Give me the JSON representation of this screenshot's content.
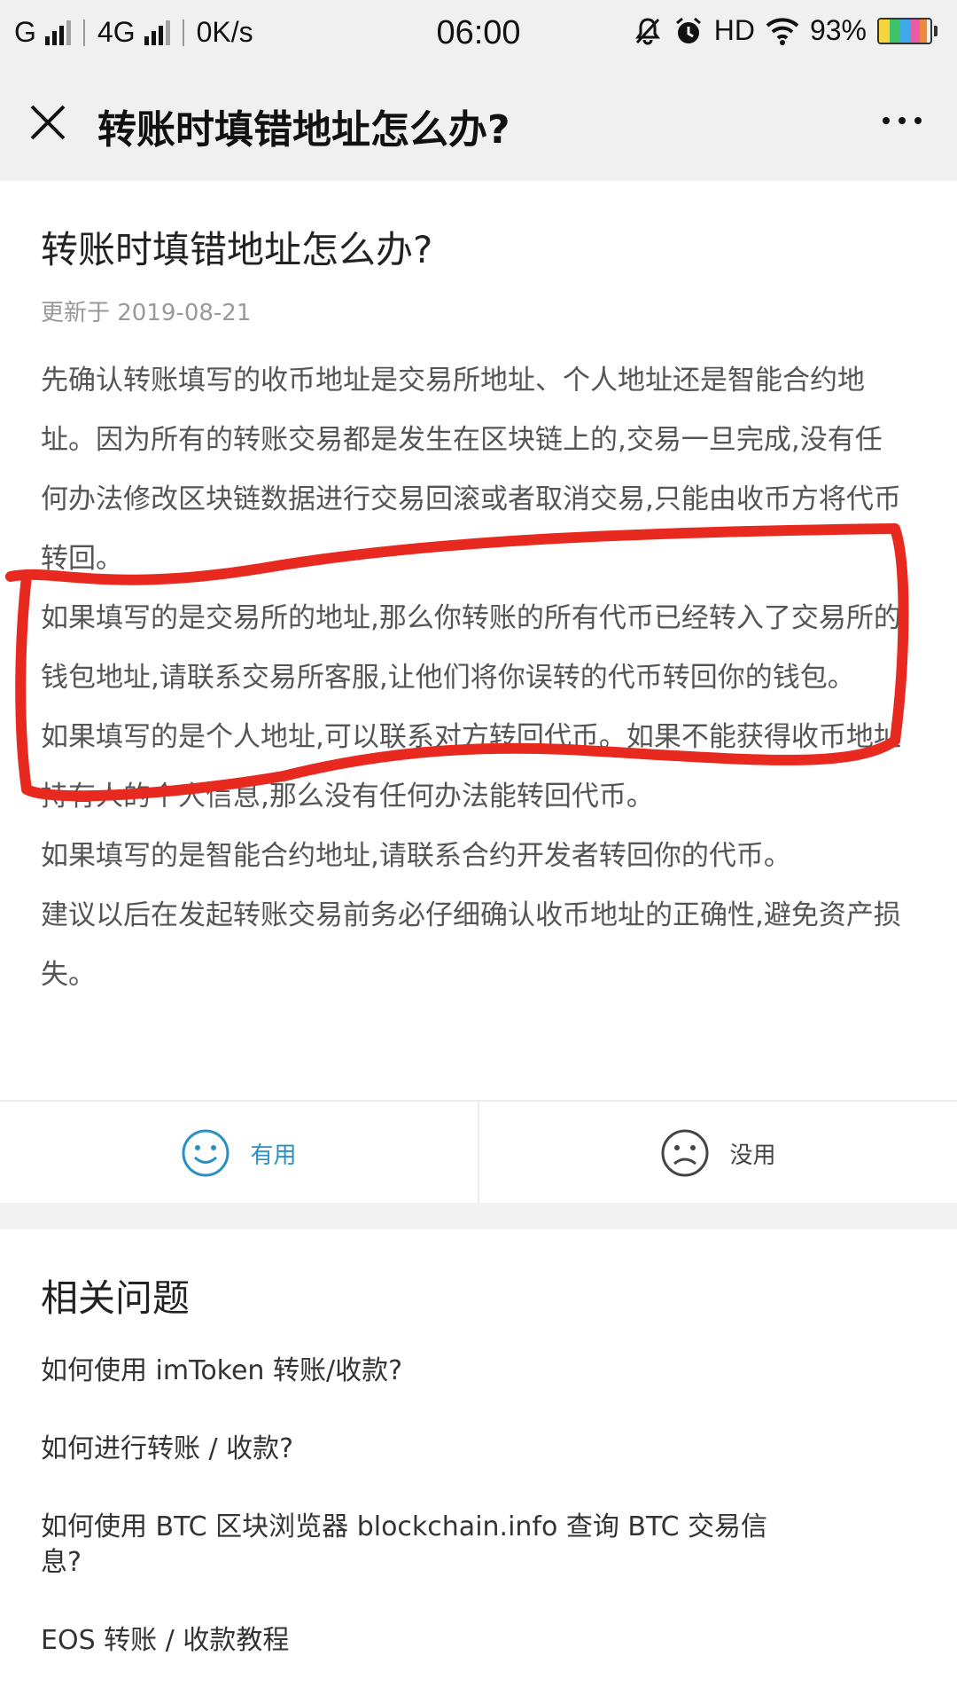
{
  "status_bar": {
    "carrier1": "G",
    "carrier2": "4G",
    "net_speed": "0K/s",
    "time": "06:00",
    "hd": "HD",
    "battery_pct": "93%",
    "battery_level": 0.93,
    "icons": [
      "signal-icon",
      "mute-bell-icon",
      "alarm-icon",
      "wifi-icon",
      "battery-icon"
    ]
  },
  "titlebar": {
    "title": "转账时填错地址怎么办?",
    "icons": [
      "close-icon",
      "more-icon"
    ]
  },
  "article": {
    "title": "转账时填错地址怎么办?",
    "date": "更新于 2019-08-21",
    "paragraphs": [
      "先确认转账填写的收币地址是交易所地址、个人地址还是智能合约地址。因为所有的转账交易都是发生在区块链上的,交易一旦完成,没有任何办法修改区块链数据进行交易回滚或者取消交易,只能由收币方将代币转回。",
      "如果填写的是交易所的地址,那么你转账的所有代币已经转入了交易所的钱包地址,请联系交易所客服,让他们将你误转的代币转回你的钱包。",
      "如果填写的是个人地址,可以联系对方转回代币。如果不能获得收币地址持有人的个人信息,那么没有任何办法能转回代币。",
      "如果填写的是智能合约地址,请联系合约开发者转回你的代币。",
      "建议以后在发起转账交易前务必仔细确认收币地址的正确性,避免资产损失。"
    ]
  },
  "annotation_color": "#e8291f",
  "feedback": {
    "useful_label": "有用",
    "useless_label": "没用",
    "useful_color": "#2a8fc4"
  },
  "related": {
    "heading": "相关问题",
    "items": [
      "如何使用 imToken 转账/收款?",
      "如何进行转账 / 收款?",
      "如何使用 BTC 区块浏览器 blockchain.info 查询 BTC 交易信息?",
      "EOS 转账 / 收款教程"
    ]
  }
}
